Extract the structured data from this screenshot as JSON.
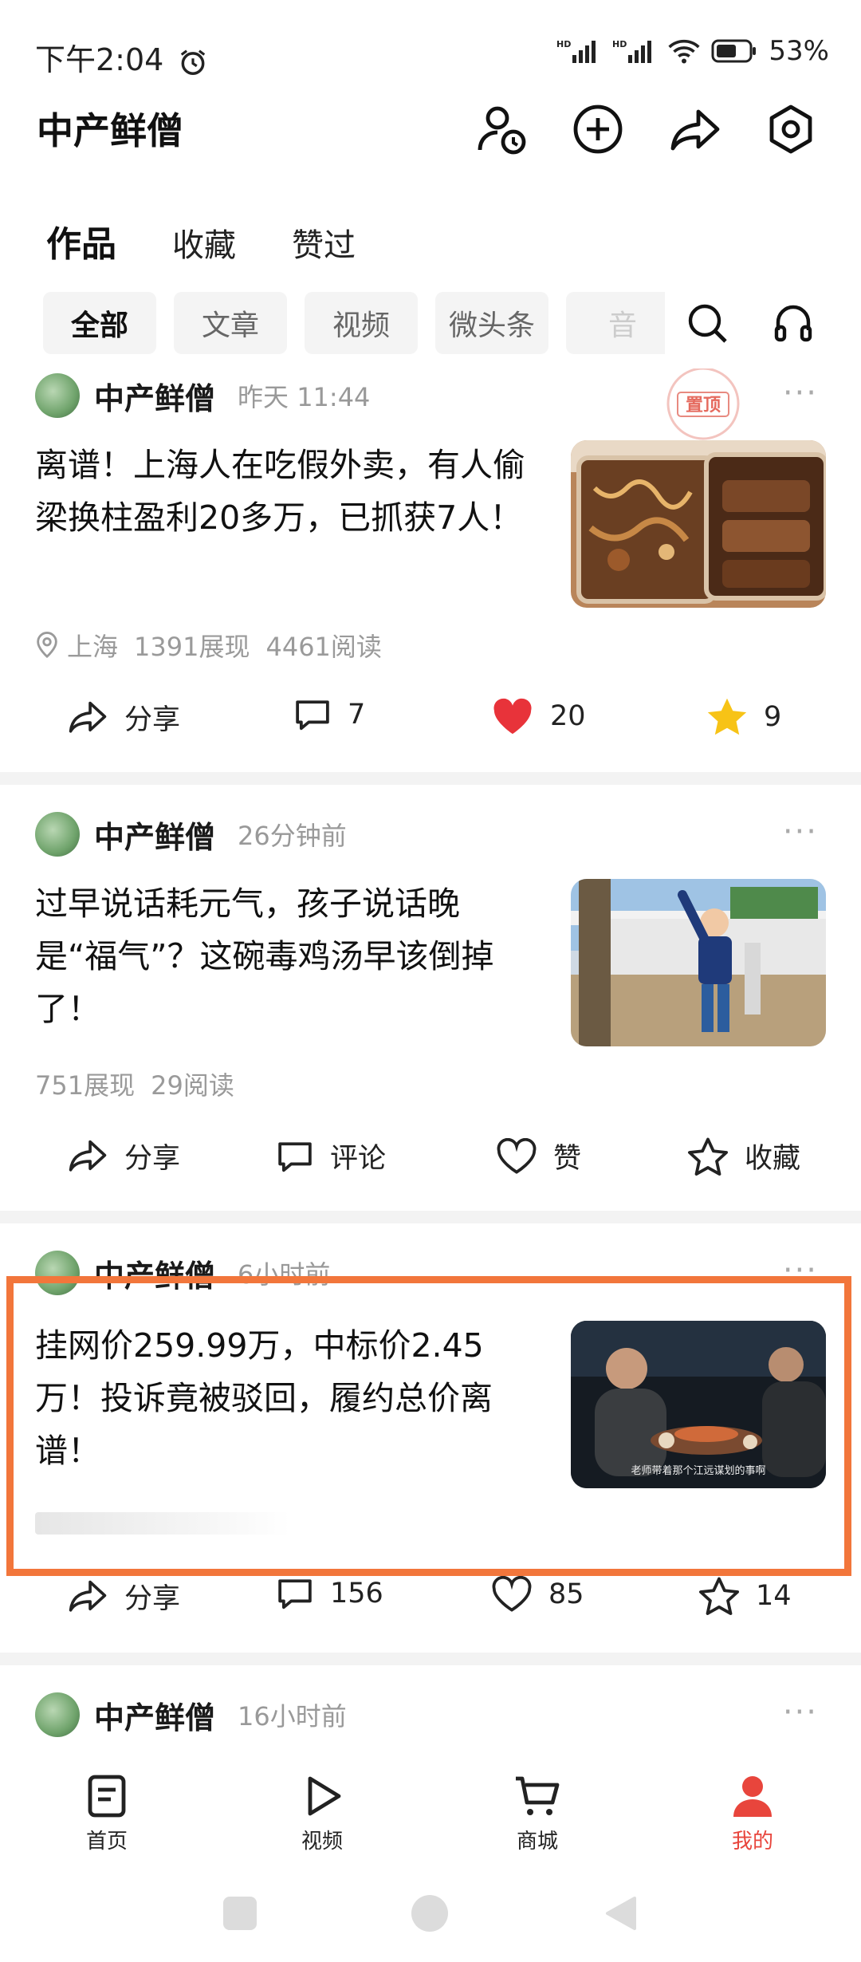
{
  "status_bar": {
    "time": "下午2:04",
    "battery": "53%"
  },
  "header": {
    "title": "中产鲜僧"
  },
  "tabs": [
    {
      "label": "作品",
      "active": true
    },
    {
      "label": "收藏",
      "active": false
    },
    {
      "label": "赞过",
      "active": false
    }
  ],
  "chips": [
    {
      "label": "全部",
      "active": true
    },
    {
      "label": "文章",
      "active": false
    },
    {
      "label": "视频",
      "active": false
    },
    {
      "label": "微头条",
      "active": false
    },
    {
      "label": "音",
      "active": false
    }
  ],
  "posts": [
    {
      "author": "中产鲜僧",
      "time": "昨天  11:44",
      "pinned_label": "置顶",
      "headline": "离谱！上海人在吃假外卖，有人偷梁换柱盈利20多万，已抓获7人！",
      "location": "上海",
      "impressions": "1391展现",
      "reads": "4461阅读",
      "share": "分享",
      "comments": "7",
      "likes": "20",
      "favorites": "9"
    },
    {
      "author": "中产鲜僧",
      "time": "26分钟前",
      "headline": "过早说话耗元气，孩子说话晚是“福气”？这碗毒鸡汤早该倒掉了！",
      "impressions": "751展现",
      "reads": "29阅读",
      "share": "分享",
      "comments": "评论",
      "likes": "赞",
      "favorites": "收藏"
    },
    {
      "author": "中产鲜僧",
      "time": "6小时前",
      "headline": "挂网价259.99万，中标价2.45万！投诉竟被驳回，履约总价离谱！",
      "thumb_caption": "老师带着那个江远谋划的事啊",
      "share": "分享",
      "comments": "156",
      "likes": "85",
      "favorites": "14"
    },
    {
      "author": "中产鲜僧",
      "time": "16小时前"
    }
  ],
  "bottom_nav": [
    {
      "label": "首页",
      "icon": "home-doc-icon",
      "active": false
    },
    {
      "label": "视频",
      "icon": "play-icon",
      "active": false
    },
    {
      "label": "商城",
      "icon": "cart-icon",
      "active": false
    },
    {
      "label": "我的",
      "icon": "person-icon",
      "active": true
    }
  ],
  "colors": {
    "accent": "#e8453c",
    "highlight": "#f2763b",
    "like_red": "#e8333a",
    "star_yellow": "#f7c316"
  }
}
